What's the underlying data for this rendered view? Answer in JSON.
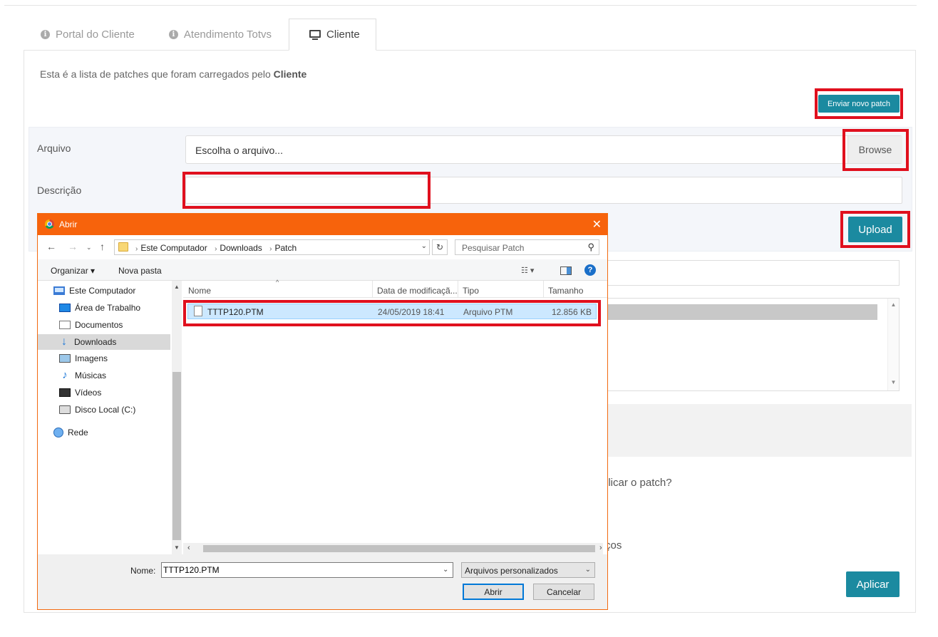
{
  "tabs": [
    {
      "label": "Portal do Cliente",
      "icon": "info-icon"
    },
    {
      "label": "Atendimento Totvs",
      "icon": "info-icon"
    },
    {
      "label": "Cliente",
      "icon": "monitor-icon",
      "active": true
    }
  ],
  "intro": {
    "text": "Esta é a lista de patches que foram carregados pelo ",
    "bold": "Cliente"
  },
  "buttons": {
    "enviar": "Enviar novo patch",
    "browse": "Browse",
    "upload": "Upload",
    "aplicar": "Aplicar"
  },
  "form": {
    "arquivo_label": "Arquivo",
    "arquivo_placeholder": "Escolha o arquivo...",
    "descricao_label": "Descrição",
    "descricao_value": ""
  },
  "background_fragments": {
    "aplicar_question": "plicar o patch?",
    "servicos": "ços"
  },
  "colors": {
    "accent": "#1b8aa0",
    "highlight": "#e0101e",
    "dialog_title": "#f7630c",
    "selection": "#cce8ff"
  },
  "dialog": {
    "title": "Abrir",
    "close": "✕",
    "breadcrumb": [
      "Este Computador",
      "Downloads",
      "Patch"
    ],
    "search_placeholder": "Pesquisar Patch",
    "toolbar": {
      "organizar": "Organizar ▾",
      "nova_pasta": "Nova pasta",
      "help": "?"
    },
    "tree": [
      {
        "label": "Este Computador",
        "icon": "computer-icon"
      },
      {
        "label": "Área de Trabalho",
        "icon": "desktop-icon"
      },
      {
        "label": "Documentos",
        "icon": "documents-icon"
      },
      {
        "label": "Downloads",
        "icon": "downloads-icon",
        "selected": true
      },
      {
        "label": "Imagens",
        "icon": "pictures-icon"
      },
      {
        "label": "Músicas",
        "icon": "music-icon"
      },
      {
        "label": "Vídeos",
        "icon": "videos-icon"
      },
      {
        "label": "Disco Local (C:)",
        "icon": "disk-icon"
      },
      {
        "label": "Rede",
        "icon": "network-icon"
      }
    ],
    "columns": [
      "Nome",
      "Data de modificaçã...",
      "Tipo",
      "Tamanho"
    ],
    "files": [
      {
        "name": "TTTP120.PTM",
        "modified": "24/05/2019 18:41",
        "type": "Arquivo PTM",
        "size": "12.856 KB"
      }
    ],
    "nome_label": "Nome:",
    "nome_value": "TTTP120.PTM",
    "filter": "Arquivos personalizados",
    "open_button": "Abrir",
    "cancel_button": "Cancelar"
  }
}
